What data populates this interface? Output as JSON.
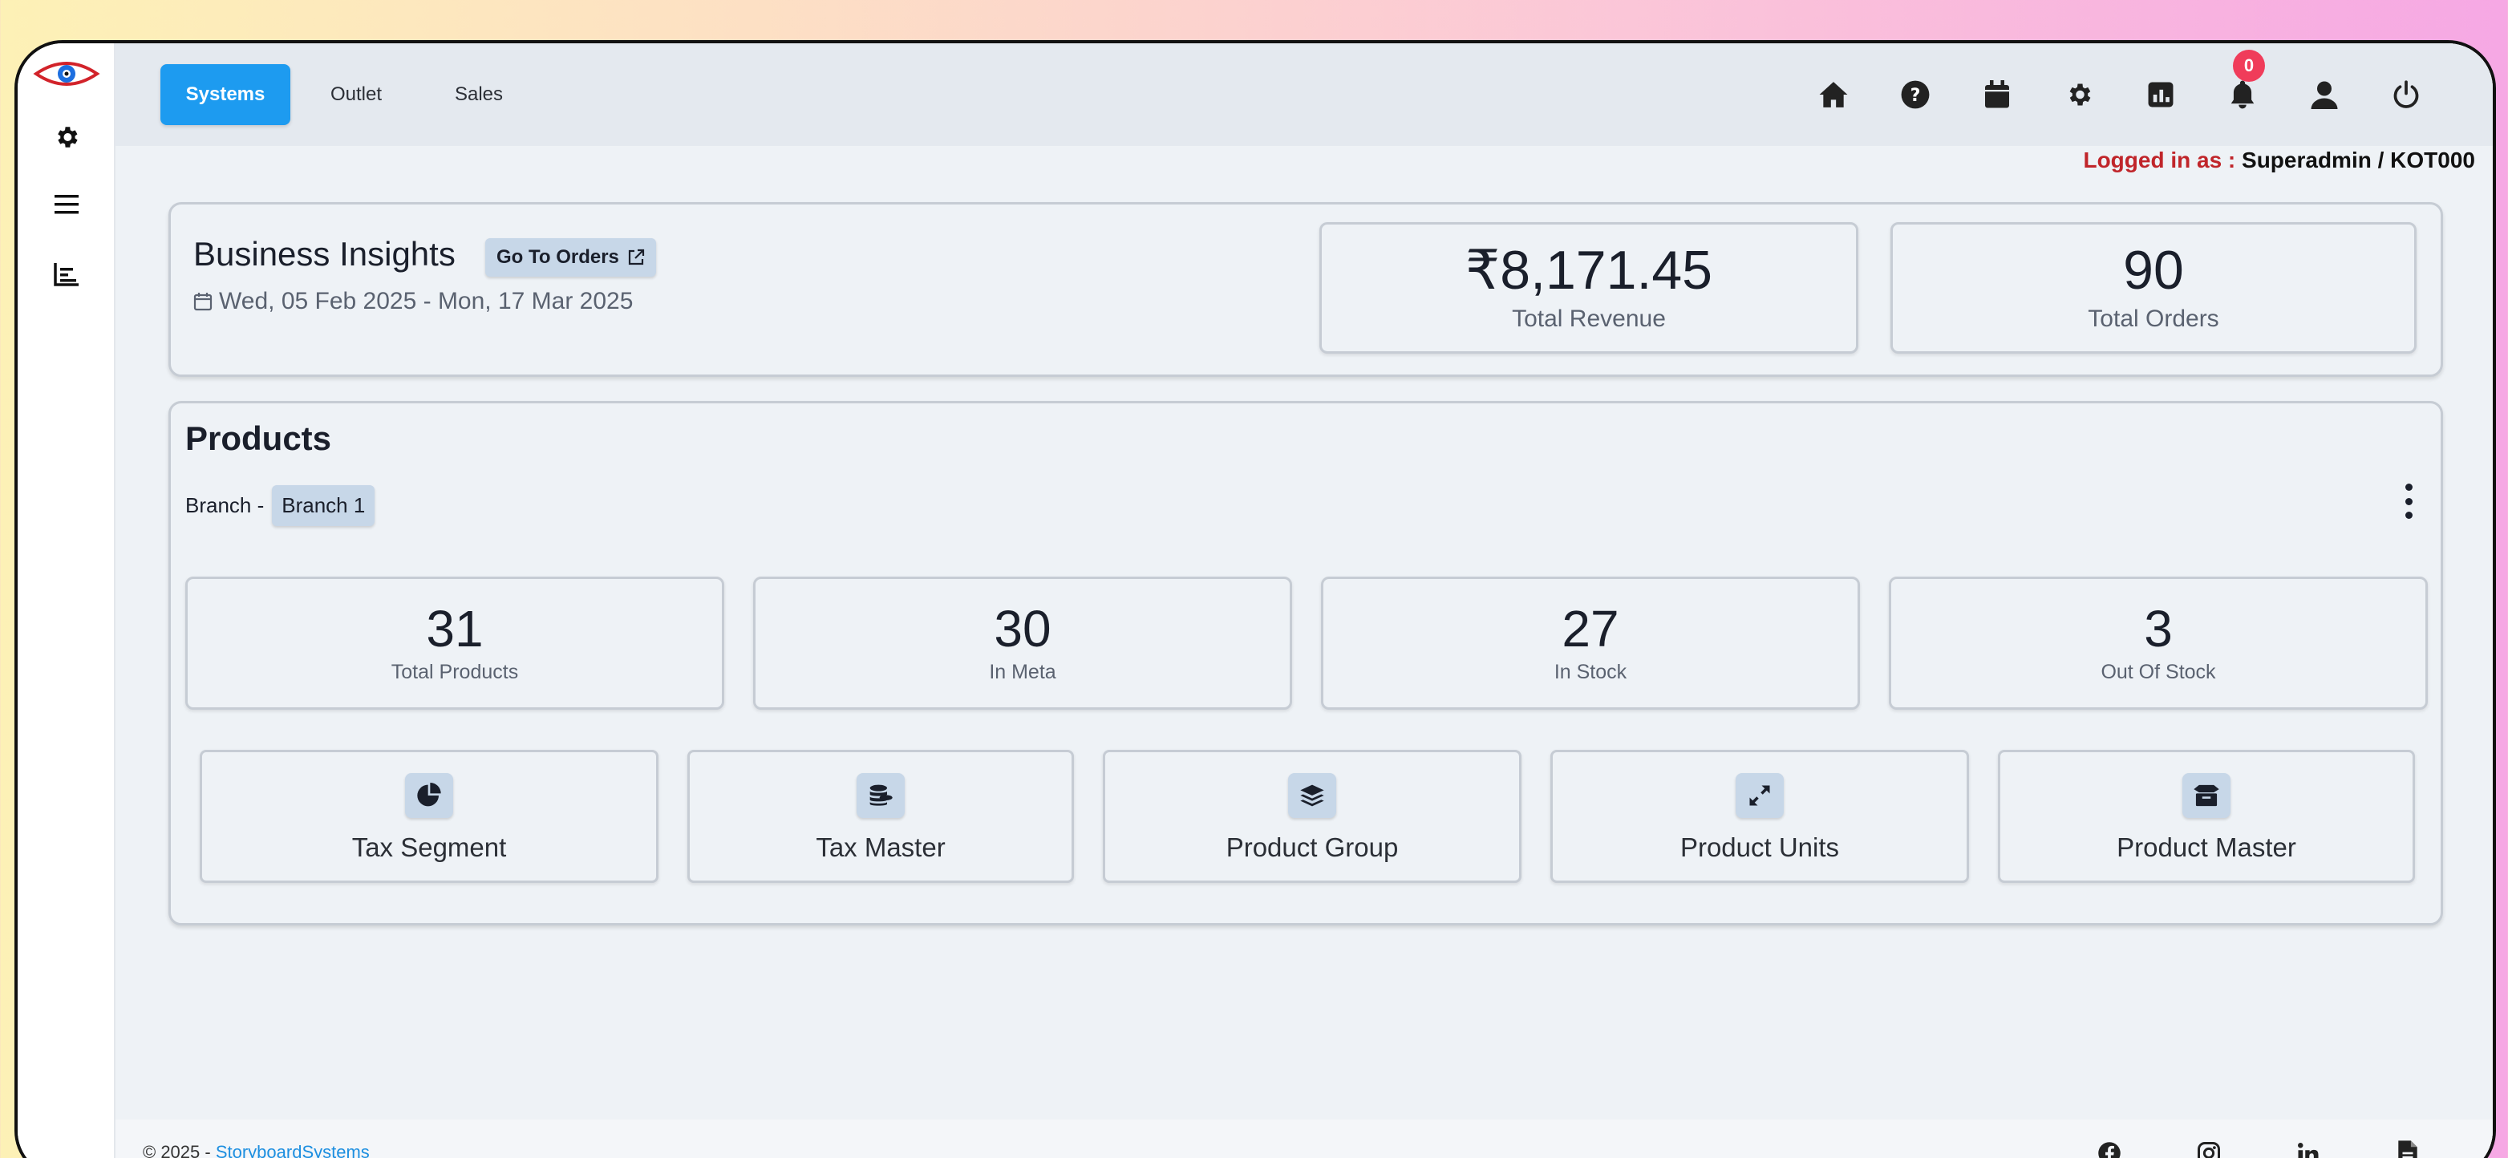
{
  "nav": {
    "tabs": [
      {
        "label": "Systems"
      },
      {
        "label": "Outlet"
      },
      {
        "label": "Sales"
      }
    ],
    "notification_count": "0"
  },
  "login": {
    "label": "Logged in as : ",
    "value": "Superadmin / KOT000"
  },
  "insights": {
    "title": "Business Insights",
    "go_to_orders": "Go To Orders",
    "date_range": "Wed, 05 Feb 2025 - Mon, 17 Mar 2025",
    "revenue_value": "₹8,171.45",
    "revenue_label": "Total Revenue",
    "orders_value": "90",
    "orders_label": "Total Orders"
  },
  "products": {
    "title": "Products",
    "branch_label": "Branch -",
    "branch_value": "Branch 1",
    "stats": [
      {
        "value": "31",
        "label": "Total Products"
      },
      {
        "value": "30",
        "label": "In Meta"
      },
      {
        "value": "27",
        "label": "In Stock"
      },
      {
        "value": "3",
        "label": "Out Of Stock"
      }
    ],
    "tiles": [
      {
        "label": "Tax Segment",
        "icon": "pie-chart-icon"
      },
      {
        "label": "Tax Master",
        "icon": "coins-icon"
      },
      {
        "label": "Product Group",
        "icon": "layers-icon"
      },
      {
        "label": "Product Units",
        "icon": "expand-icon"
      },
      {
        "label": "Product Master",
        "icon": "box-icon"
      }
    ]
  },
  "footer": {
    "copyright": "© 2025 - ",
    "brand": "StoryboardSystems"
  },
  "colors": {
    "accent": "#1d9bf0",
    "login_label": "#c0252a",
    "badge": "#f03c5a"
  }
}
